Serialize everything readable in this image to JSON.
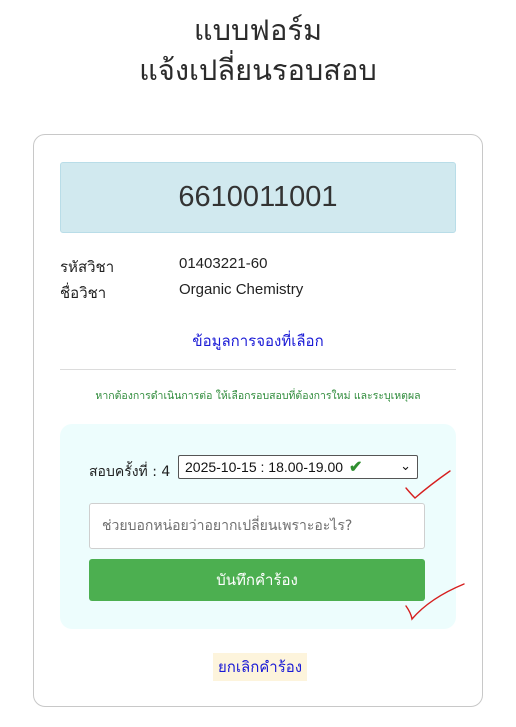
{
  "page": {
    "title_line1": "แบบฟอร์ม",
    "title_line2": "แจ้งเปลี่ยนรอบสอบ"
  },
  "student": {
    "id": "6610011001"
  },
  "course": {
    "code_label": "รหัสวิชา",
    "code_value": "01403221-60",
    "name_label": "ชื่อวิชา",
    "name_value": "Organic Chemistry"
  },
  "booking_link": "ข้อมูลการจองที่เลือก",
  "hint": "หากต้องการดำเนินการต่อ ให้เลือกรอบสอบที่ต้องการใหม่ และระบุเหตุผล",
  "form": {
    "exam_label": "สอบครั้งที่ : 4",
    "selected_slot": "2025-10-15 : 18.00-19.00",
    "check_glyph": "✔",
    "chevron_glyph": "⌄",
    "reason_placeholder": "ช่วยบอกหน่อยว่าอยากเปลี่ยนเพราะอะไร?",
    "reason_value": "",
    "save_label": "บันทึกคำร้อง"
  },
  "cancel_label": "ยกเลิกคำร้อง",
  "colors": {
    "id_box_bg": "#d1e9ef",
    "link": "#1a1ad6",
    "hint": "#2e8b3a",
    "panel_bg": "#edfdfd",
    "save_bg": "#4caf50",
    "cancel_bg": "#fdf4dc",
    "annotation_marks": "#d61f1f"
  }
}
